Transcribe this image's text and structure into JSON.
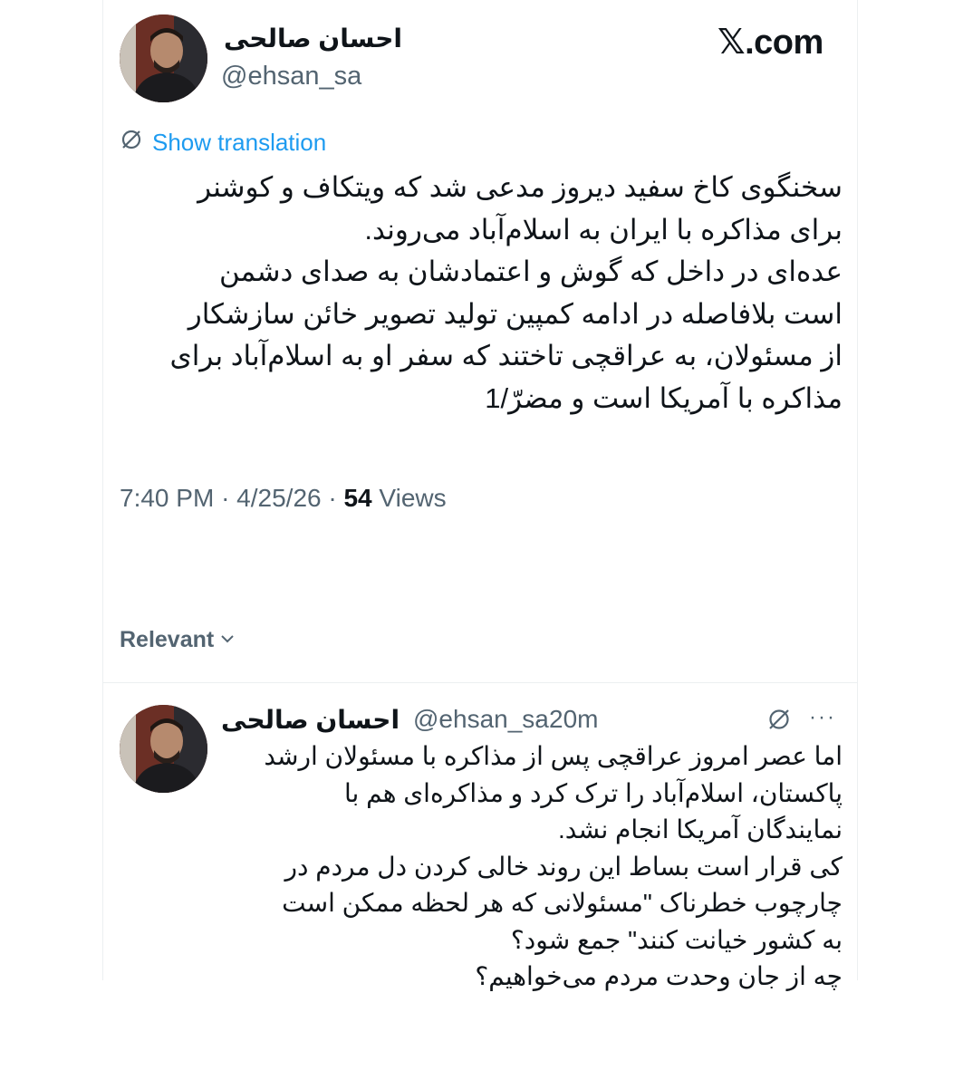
{
  "header": {
    "author_name": "احسان صالحی",
    "author_handle": "@ehsan_sa",
    "brand": "𝕏.com"
  },
  "tweet": {
    "translate_label": "Show translation",
    "text_lines": [
      "سخنگوی کاخ سفید دیروز مدعی شد که ویتکاف و کوشنر",
      "برای مذاکره با ایران به اسلام‌آباد می‌روند.",
      "عده‌ای در داخل که گوش و اعتمادشان به صدای دشمن",
      "است بلافاصله در ادامه کمپین تولید تصویر خائن سازشکار",
      "از مسئولان، به عراقچی تاختند که سفر او به اسلام‌آباد برای",
      "مذاکره با آمریکا است و مضرّ/1"
    ],
    "time": "7:40 PM",
    "date": "4/25/26",
    "views_count": "54",
    "views_label": "Views",
    "separator": "·"
  },
  "replies_sort": {
    "label": "Relevant"
  },
  "reply": {
    "author_name": "احسان صالحی",
    "author_handle": "@ehsan_sa",
    "separator": "·",
    "time_ago": "20m",
    "more_label": "···",
    "text_lines": [
      "اما عصر امروز عراقچی پس از مذاکره با مسئولان ارشد",
      "پاکستان، اسلام‌آباد را ترک کرد و مذاکره‌ای هم با",
      "نمایندگان آمریکا انجام نشد.",
      "کی قرار است بساط این روند خالی کردن دل مردم در",
      "چارچوب خطرناک \"مسئولانی که هر لحظه ممکن است",
      "به کشور خیانت کنند\" جمع شود؟",
      "چه از جان وحدت مردم می‌خواهیم؟"
    ]
  },
  "colors": {
    "accent": "#1d9bf0",
    "secondary_text": "#536471",
    "primary_text": "#0f1419"
  }
}
